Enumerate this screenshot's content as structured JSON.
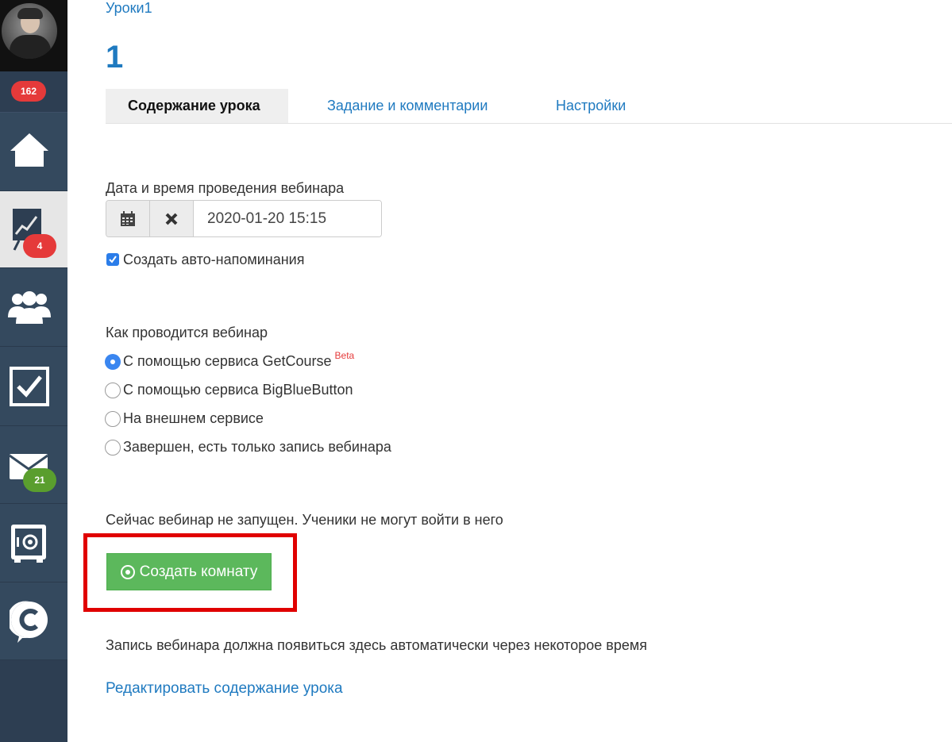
{
  "sidebar": {
    "counter_badge": "162",
    "items": [
      {
        "name": "home",
        "icon": "home-icon",
        "badge": ""
      },
      {
        "name": "training",
        "icon": "chart-board-icon",
        "badge": "4",
        "active": true
      },
      {
        "name": "users",
        "icon": "users-icon",
        "badge": ""
      },
      {
        "name": "tasks",
        "icon": "checkbox-icon",
        "badge": ""
      },
      {
        "name": "messages",
        "icon": "mail-icon",
        "badge": "21"
      },
      {
        "name": "safe",
        "icon": "safe-icon",
        "badge": ""
      },
      {
        "name": "getcourse",
        "icon": "getcourse-logo-icon",
        "badge": ""
      }
    ]
  },
  "breadcrumb": "Уроки1",
  "page_title": "1",
  "tabs": [
    {
      "label": "Содержание урока",
      "active": true
    },
    {
      "label": "Задание и комментарии",
      "active": false
    },
    {
      "label": "Настройки",
      "active": false
    }
  ],
  "webinar": {
    "datetime_label": "Дата и время проведения вебинара",
    "datetime_value": "2020-01-20 15:15",
    "reminder_label": "Создать авто-напоминания",
    "reminder_checked": true,
    "method_label": "Как проводится вебинар",
    "methods": [
      {
        "label": "С помощью сервиса GetCourse",
        "tag": "Beta",
        "selected": true
      },
      {
        "label": "С помощью сервиса BigBlueButton",
        "selected": false
      },
      {
        "label": "На внешнем сервисе",
        "selected": false
      },
      {
        "label": "Завершен, есть только запись вебинара",
        "selected": false
      }
    ],
    "status_text": "Сейчас вебинар не запущен. Ученики не могут войти в него",
    "create_room_label": "Создать комнату",
    "recording_note": "Запись вебинара должна появиться здесь автоматически через некоторое время",
    "edit_link": "Редактировать содержание урока"
  },
  "colors": {
    "sidebar_bg": "#34495e",
    "link": "#1f7ac0",
    "badge_red": "#e53a3a",
    "badge_green": "#5a9e2e",
    "button_green": "#5cb85c",
    "highlight_red": "#e00000"
  }
}
